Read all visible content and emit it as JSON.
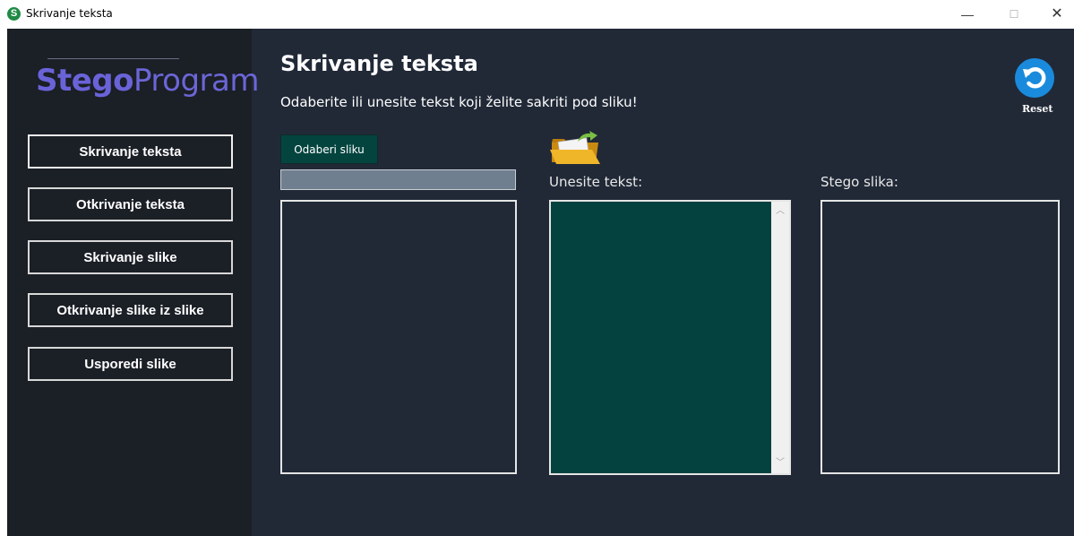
{
  "window": {
    "title": "Skrivanje teksta",
    "app_icon_letter": "S",
    "minimize_glyph": "—",
    "maximize_glyph": "☐",
    "close_glyph": "✕"
  },
  "logo": {
    "part1": "Stego",
    "part2": "Program"
  },
  "sidebar": {
    "items": [
      {
        "label": "Skrivanje teksta",
        "active": true
      },
      {
        "label": "Otkrivanje teksta",
        "active": false
      },
      {
        "label": "Skrivanje slike",
        "active": false
      },
      {
        "label": "Otkrivanje slike iz slike",
        "active": false
      },
      {
        "label": "Usporedi slike",
        "active": false
      }
    ]
  },
  "main": {
    "title": "Skrivanje teksta",
    "subtitle": "Odaberite ili unesite tekst koji želite sakriti pod sliku!",
    "choose_image_label": "Odaberi sliku",
    "image_path_value": "",
    "text_label": "Unesite tekst:",
    "text_value": "",
    "stego_label": "Stego slika:",
    "reset_label": "Reset"
  },
  "icons": {
    "reset": "reset-icon",
    "folder": "open-folder-icon"
  },
  "colors": {
    "background": "#212937",
    "sidebar": "#1b1f26",
    "logo": "#6a63d8",
    "accent_teal": "#03443f",
    "reset_blue": "#1a8bdc"
  }
}
